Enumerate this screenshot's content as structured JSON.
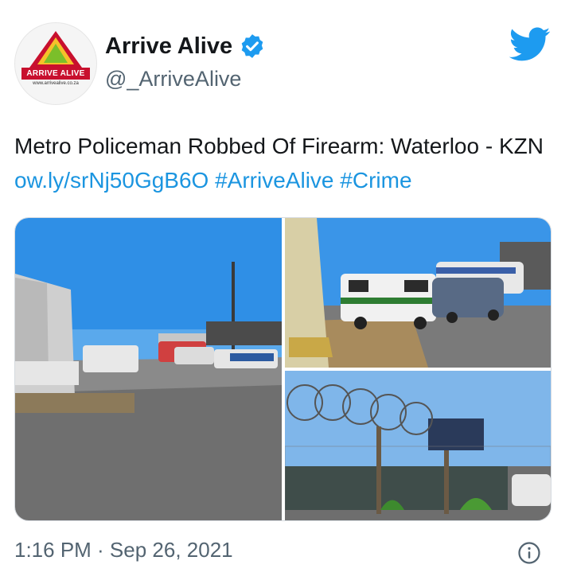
{
  "author": {
    "display_name": "Arrive Alive",
    "handle": "@_ArriveAlive",
    "verified": true,
    "avatar": {
      "brand_text": "ARRIVE ALIVE",
      "site_text": "www.arrivealive.co.za"
    }
  },
  "tweet": {
    "text_plain": "Metro Policeman Robbed Of Firearm: Waterloo - KZN",
    "link": "ow.ly/srNj50GgB6O",
    "hashtags": [
      "#ArriveAlive",
      "#Crime"
    ]
  },
  "media": {
    "photos": [
      {
        "description": "Police vehicles parked near a road by a building under blue sky"
      },
      {
        "description": "Police van and cars parked beside a wall"
      },
      {
        "description": "Razor wire fence with a sign and shacks behind it"
      }
    ]
  },
  "footer": {
    "timestamp": "1:16 PM · Sep 26, 2021"
  },
  "icons": {
    "verified": "verified-badge-icon",
    "twitter": "twitter-bird-icon",
    "info": "info-icon"
  },
  "colors": {
    "link": "#1b95e0",
    "verified": "#1d9bf0",
    "twitter_blue": "#1d9bf0",
    "muted": "#536471"
  }
}
